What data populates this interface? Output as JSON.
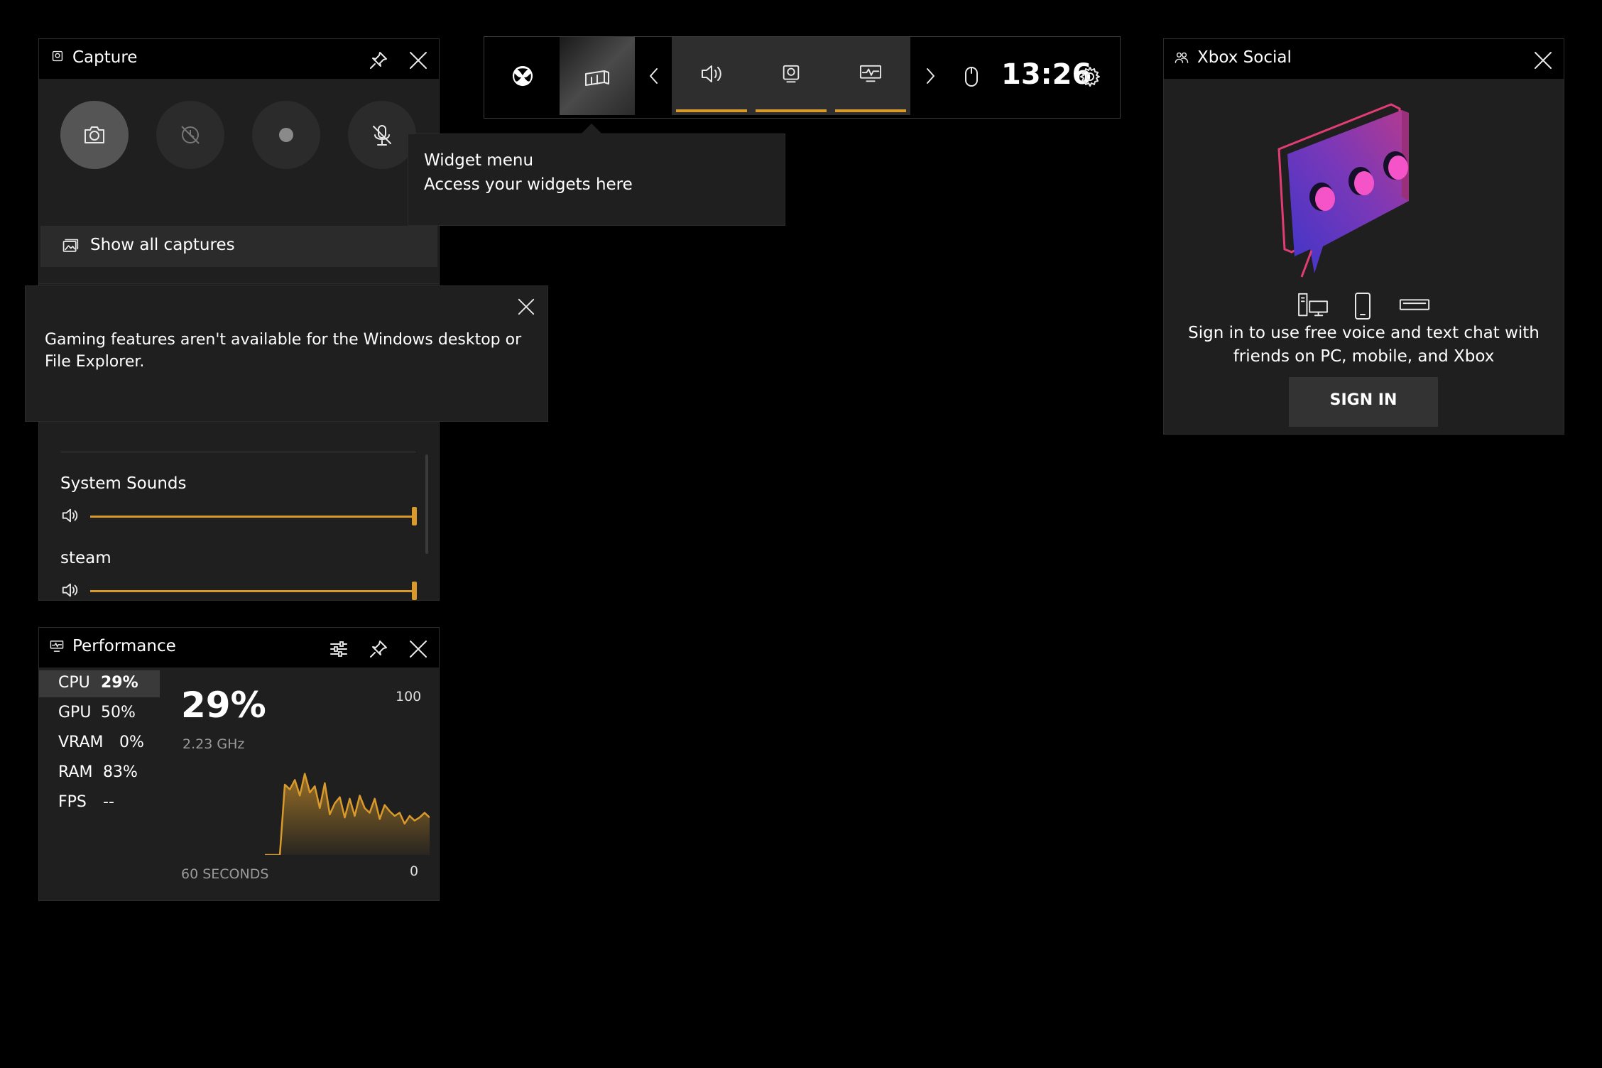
{
  "capture": {
    "title": "Capture",
    "show_all_label": "Show all captures"
  },
  "notification": {
    "message": "Gaming features aren't available for the Windows desktop or File Explorer."
  },
  "audio": {
    "apps": [
      {
        "name": "System Sounds",
        "volume": 100
      },
      {
        "name": "steam",
        "volume": 100
      }
    ]
  },
  "topbar": {
    "time": "13:26",
    "tooltip_title": "Widget menu",
    "tooltip_body": "Access your widgets here"
  },
  "performance": {
    "title": "Performance",
    "metrics": [
      {
        "name": "CPU",
        "value": "29%"
      },
      {
        "name": "GPU",
        "value": "50%"
      },
      {
        "name": "VRAM",
        "value": "0%"
      },
      {
        "name": "RAM",
        "value": "83%"
      },
      {
        "name": "FPS",
        "value": "--"
      }
    ],
    "big_value": "29%",
    "freq": "2.23 GHz",
    "axis_max": "100",
    "axis_min": "0",
    "window_label": "60 SECONDS",
    "accent": "#d99a2b"
  },
  "chart_data": {
    "type": "area",
    "ylim": [
      0,
      100
    ],
    "values": [
      0,
      0,
      0,
      0,
      45,
      42,
      48,
      38,
      52,
      40,
      44,
      30,
      46,
      26,
      33,
      37,
      24,
      36,
      25,
      38,
      30,
      27,
      36,
      23,
      32,
      28,
      25,
      27,
      20,
      25,
      22,
      24,
      27,
      24
    ]
  },
  "social": {
    "title": "Xbox Social",
    "message": "Sign in to use free voice and text chat with friends on PC, mobile, and Xbox",
    "sign_in_label": "SIGN IN"
  },
  "colors": {
    "accent": "#d99a2b",
    "panel_bg": "#1f1f1f",
    "header_bg": "#000000"
  }
}
